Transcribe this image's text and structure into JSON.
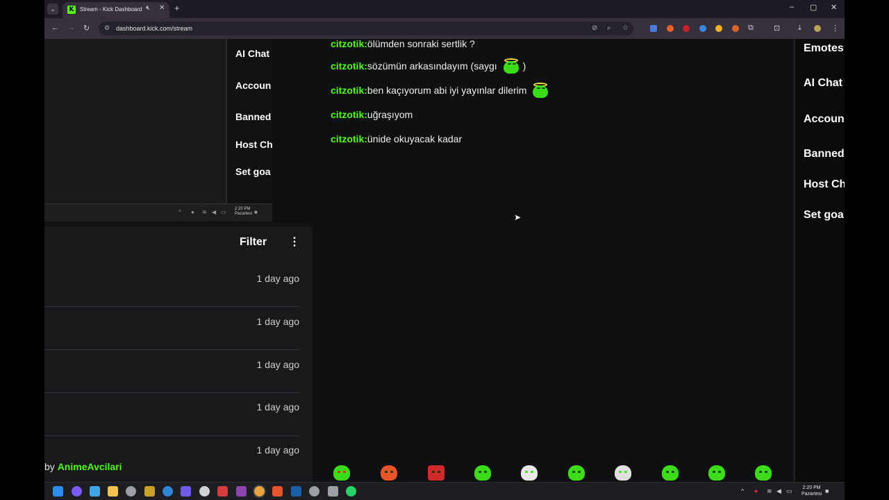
{
  "browser": {
    "tab_title": "Stream - Kick Dashboard",
    "url": "dashboard.kick.com/stream",
    "favicon_letter": "K"
  },
  "preview_menu": [
    "AI Chat",
    "Accoun",
    "Banned",
    "Host Ch",
    "Set goa"
  ],
  "preview_clock": {
    "time": "2:20 PM",
    "day": "Pazartesi"
  },
  "activity": {
    "filter_label": "Filter",
    "items": [
      "1 day ago",
      "1 day ago",
      "1 day ago",
      "1 day ago",
      "1 day ago"
    ],
    "byline_prefix": "by ",
    "byline_user": "AnimeAvcilari"
  },
  "chat": {
    "messages": [
      {
        "user": "citzotik",
        "sep": ": ",
        "text": "ölümden sonraki sertlik ?"
      },
      {
        "user": "citzotik",
        "sep": ": ",
        "text": "sözümün arkasındayım (saygı",
        "emote": "halo-emote",
        "suffix": ")"
      },
      {
        "user": "citzotik",
        "sep": ": ",
        "text": "ben kaçıyorum abi iyi yayınlar dilerim",
        "emote": "halo-emote"
      },
      {
        "user": "citzotik",
        "sep": ": ",
        "text": "uğraşıyom"
      },
      {
        "user": "citzotik",
        "sep": ": ",
        "text": "ünide okuyacak kadar"
      }
    ],
    "emote_bar": [
      "heart-eyes-emote",
      "cowboy-emote",
      "angry-emote",
      "halo-emote",
      "clown-emote",
      "grin-emote",
      "headset-emote",
      "smile-emote",
      "stare-emote",
      "wink-emote"
    ]
  },
  "right_menu": [
    "Emotes",
    "AI Chat",
    "Accoun",
    "Banned",
    "Host Ch",
    "Set goa"
  ],
  "taskbar": {
    "time": "2:20 PM",
    "day": "Pazartesi"
  },
  "colors": {
    "kick_green": "#53fc18",
    "panel": "#18191b",
    "chat_bg": "#0f1011"
  }
}
